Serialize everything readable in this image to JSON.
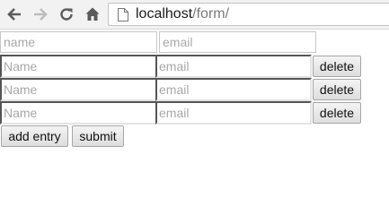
{
  "browser": {
    "url_host": "localhost",
    "url_path": "/form/"
  },
  "form": {
    "first_row": {
      "name_placeholder": "name",
      "email_placeholder": "email"
    },
    "entries": [
      {
        "name_placeholder": "Name",
        "email_placeholder": "email",
        "delete_label": "delete"
      },
      {
        "name_placeholder": "Name",
        "email_placeholder": "email",
        "delete_label": "delete"
      },
      {
        "name_placeholder": "Name",
        "email_placeholder": "email",
        "delete_label": "delete"
      }
    ],
    "add_entry_label": "add entry",
    "submit_label": "submit"
  }
}
